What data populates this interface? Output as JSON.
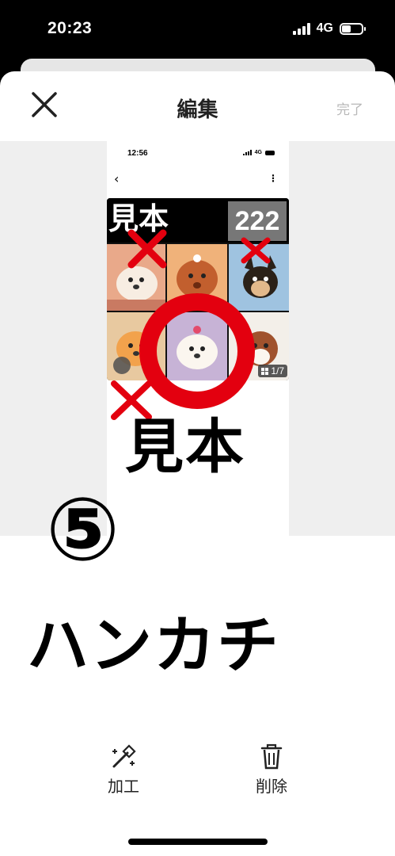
{
  "status_bar": {
    "time": "20:23",
    "network": "4G"
  },
  "nav": {
    "title": "編集",
    "done_label": "完了",
    "close_icon": "close-icon"
  },
  "inner_screenshot": {
    "status_time": "12:56",
    "status_network": "4G",
    "back_icon": "chevron-left-icon",
    "more_icon": "more-vertical-icon",
    "photo_label": "見本",
    "photo_badge": "222",
    "counter": "1/7"
  },
  "overlays": {
    "sample_text": "見本",
    "number": "⑤",
    "item_name": "ハンカチ",
    "circle_color": "#e3000f",
    "cross_color": "#e3000f"
  },
  "toolbar": {
    "edit_label": "加工",
    "edit_icon": "magic-wand-icon",
    "delete_label": "削除",
    "delete_icon": "trash-icon"
  }
}
